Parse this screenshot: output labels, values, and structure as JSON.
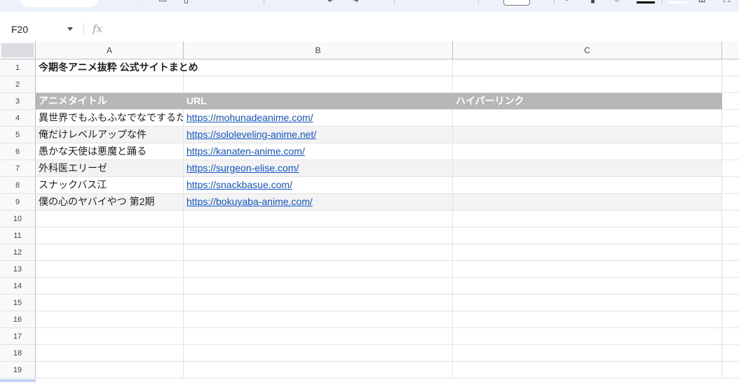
{
  "formula_bar": {
    "cell_ref": "F20",
    "fx_label": "fx",
    "value": ""
  },
  "columns": [
    "A",
    "B",
    "C"
  ],
  "rows": [
    {
      "num": "1",
      "a": "今期冬アニメ抜粋 公式サイトまとめ",
      "b": "",
      "c": "",
      "style": "title"
    },
    {
      "num": "2",
      "a": "",
      "b": "",
      "c": "",
      "style": "plain"
    },
    {
      "num": "3",
      "a": "アニメタイトル",
      "b": "URL",
      "c": "ハイパーリンク",
      "style": "header"
    },
    {
      "num": "4",
      "a": "異世界でもふもふなでなでするためにがんばってます。",
      "b": "https://mohunadeanime.com/",
      "c": "",
      "style": "data"
    },
    {
      "num": "5",
      "a": "俺だけレベルアップな件",
      "b": "https://sololeveling-anime.net/",
      "c": "",
      "style": "data-alt"
    },
    {
      "num": "6",
      "a": "愚かな天使は悪魔と踊る",
      "b": "https://kanaten-anime.com/",
      "c": "",
      "style": "data"
    },
    {
      "num": "7",
      "a": "外科医エリーゼ",
      "b": "https://surgeon-elise.com/",
      "c": "",
      "style": "data-alt"
    },
    {
      "num": "8",
      "a": "スナックバス江",
      "b": "https://snackbasue.com/",
      "c": "",
      "style": "data"
    },
    {
      "num": "9",
      "a": "僕の心のヤバイやつ 第2期",
      "b": "https://bokuyaba-anime.com/",
      "c": "",
      "style": "data-alt"
    },
    {
      "num": "10",
      "a": "",
      "b": "",
      "c": "",
      "style": "plain"
    },
    {
      "num": "11",
      "a": "",
      "b": "",
      "c": "",
      "style": "plain"
    },
    {
      "num": "12",
      "a": "",
      "b": "",
      "c": "",
      "style": "plain"
    },
    {
      "num": "13",
      "a": "",
      "b": "",
      "c": "",
      "style": "plain"
    },
    {
      "num": "14",
      "a": "",
      "b": "",
      "c": "",
      "style": "plain"
    },
    {
      "num": "15",
      "a": "",
      "b": "",
      "c": "",
      "style": "plain"
    },
    {
      "num": "16",
      "a": "",
      "b": "",
      "c": "",
      "style": "plain"
    },
    {
      "num": "17",
      "a": "",
      "b": "",
      "c": "",
      "style": "plain"
    },
    {
      "num": "18",
      "a": "",
      "b": "",
      "c": "",
      "style": "plain"
    },
    {
      "num": "19",
      "a": "",
      "b": "",
      "c": "",
      "style": "plain"
    }
  ],
  "colors": {
    "header_fill": "#b7b7b7",
    "alt_row_fill": "#f3f3f3",
    "link": "#1155cc",
    "toolbar_bg": "#edf2fa"
  }
}
